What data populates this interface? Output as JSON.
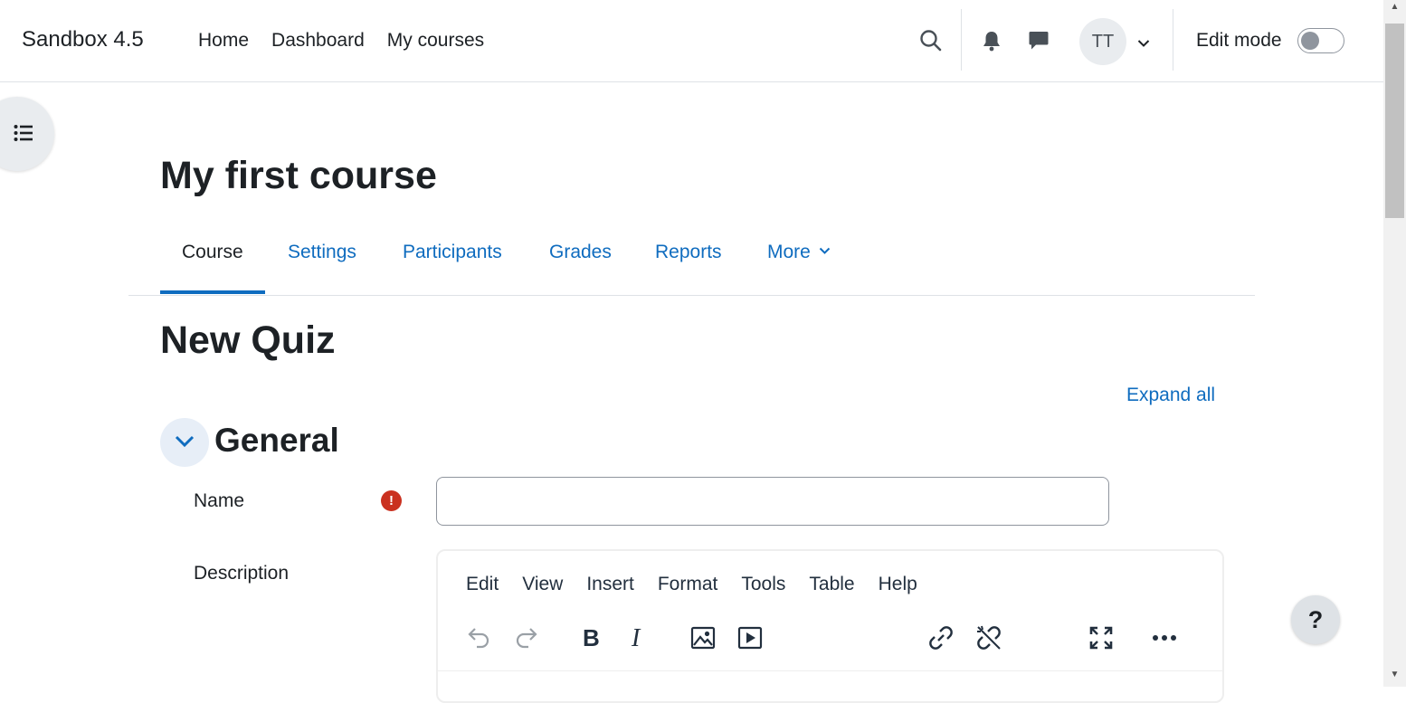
{
  "navbar": {
    "brand": "Sandbox 4.5",
    "links": [
      "Home",
      "Dashboard",
      "My courses"
    ],
    "user_initials": "TT",
    "edit_mode_label": "Edit mode",
    "edit_mode_on": false,
    "icons": [
      "search-icon",
      "bell-icon",
      "message-icon",
      "chevron-down-icon"
    ]
  },
  "course": {
    "title": "My first course",
    "tabs": [
      "Course",
      "Settings",
      "Participants",
      "Grades",
      "Reports",
      "More"
    ],
    "active_tab": "Course"
  },
  "page": {
    "heading": "New Quiz",
    "expand_all": "Expand all"
  },
  "section": {
    "title": "General"
  },
  "form": {
    "name_label": "Name",
    "name_value": "",
    "required_symbol": "!",
    "description_label": "Description"
  },
  "editor": {
    "menu": [
      "Edit",
      "View",
      "Insert",
      "Format",
      "Tools",
      "Table",
      "Help"
    ],
    "toolbar_icons": [
      "undo-icon",
      "redo-icon",
      "bold-icon",
      "italic-icon",
      "image-icon",
      "media-icon",
      "link-icon",
      "unlink-icon",
      "fullscreen-icon",
      "more-icon"
    ]
  },
  "help": {
    "label": "?"
  },
  "colors": {
    "accent": "#0f6cbf",
    "text": "#1d2125",
    "required": "#ca3120",
    "border": "#dee2e6"
  }
}
